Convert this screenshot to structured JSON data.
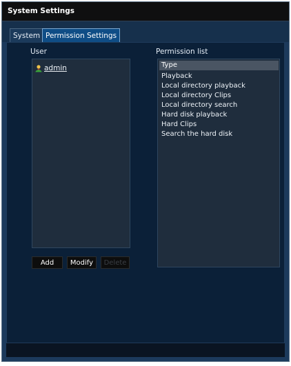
{
  "window": {
    "title": "System Settings"
  },
  "tabs": [
    {
      "label": "System"
    },
    {
      "label": "Permission Settings"
    }
  ],
  "user_panel": {
    "label": "User",
    "users": [
      {
        "name": "admin"
      }
    ]
  },
  "buttons": {
    "add": "Add",
    "modify": "Modify",
    "delete": "Delete"
  },
  "permission_panel": {
    "label": "Permission list",
    "header": "Type",
    "items": [
      "Playback",
      "Local directory playback",
      "Local directory Clips",
      "Local directory search",
      "Hard disk playback",
      "Hard Clips",
      "Search the hard disk"
    ]
  },
  "icons": {
    "user": "user-icon"
  },
  "colors": {
    "accent_tab": "#0f4d86",
    "panel_bg": "#1f2d3d",
    "window_bg": "#1c3a5c"
  }
}
